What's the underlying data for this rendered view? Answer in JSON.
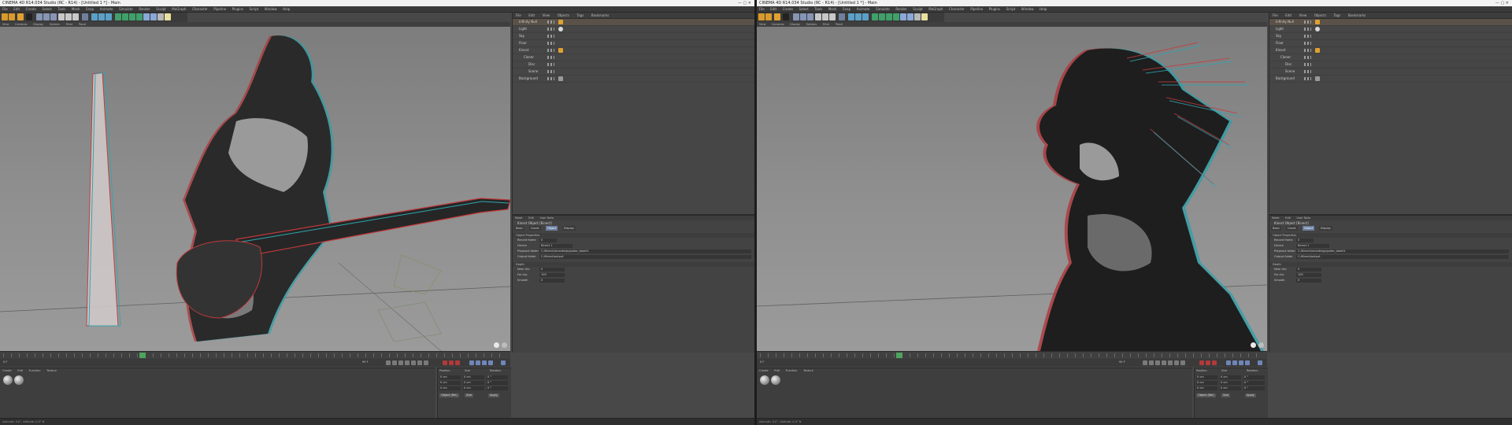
{
  "app": {
    "window_title": "CINEMA 4D R14.034 Studio (RC - R14) - [Untitled 1 *] - Main",
    "window_controls": "—  ▢  ✕"
  },
  "menus": [
    "File",
    "Edit",
    "Create",
    "Select",
    "Tools",
    "Mesh",
    "Snap",
    "Animate",
    "Simulate",
    "Render",
    "Sculpt",
    "MoGraph",
    "Character",
    "Pipeline",
    "Plugins",
    "Script",
    "Window",
    "Help"
  ],
  "viewport": {
    "menu": [
      "View",
      "Cameras",
      "Display",
      "Options",
      "Filter",
      "Panel"
    ]
  },
  "object_manager": {
    "menu": [
      "File",
      "Edit",
      "View",
      "Objects",
      "Tags",
      "Bookmarks"
    ],
    "objects": [
      {
        "name": "Infinity Null",
        "selected": true
      },
      {
        "name": "Light",
        "selected": false
      },
      {
        "name": "Sky",
        "selected": false
      },
      {
        "name": "Floor",
        "selected": false
      },
      {
        "name": "Kinect",
        "selected": false
      },
      {
        "name": "Cloner",
        "selected": false
      },
      {
        "name": "Disc",
        "selected": false
      },
      {
        "name": "Scene",
        "selected": false
      },
      {
        "name": "Background",
        "selected": false
      }
    ]
  },
  "attribute_manager": {
    "tabs": [
      "Mode",
      "Edit",
      "User Data"
    ],
    "title": "Kinect Object [Kinect]",
    "subtabs": [
      "Basic",
      "Coord.",
      "Object",
      "Display"
    ],
    "active_subtab": "Object",
    "section_title": "Object Properties",
    "fields": [
      {
        "key": "Record frame",
        "value": "0"
      },
      {
        "key": "Device",
        "value": "Kinect 1"
      },
      {
        "key": "Playback folder",
        "value": "C:/Kinect/recordings/guitar_take01"
      },
      {
        "key": "Output folder",
        "value": "C:/Kinect/output"
      }
    ],
    "section2": "Depth",
    "fields2": [
      {
        "key": "Near clip",
        "value": "0"
      },
      {
        "key": "Far clip",
        "value": "100"
      },
      {
        "key": "Smooth",
        "value": "0"
      }
    ]
  },
  "timeline": {
    "start": "0 F",
    "end": "90 F",
    "current_frame": "27 F",
    "playhead_fraction": 0.27
  },
  "material_manager": {
    "menu": [
      "Create",
      "Edit",
      "Function",
      "Texture"
    ]
  },
  "coordinates": {
    "headers": [
      "Position",
      "Size",
      "Rotation"
    ],
    "rows": [
      [
        "X",
        "0 cm",
        "X",
        "0 cm",
        "H",
        "0 °"
      ],
      [
        "Y",
        "0 cm",
        "Y",
        "0 cm",
        "P",
        "0 °"
      ],
      [
        "Z",
        "0 cm",
        "Z",
        "0 cm",
        "B",
        "0 °"
      ]
    ],
    "mode": "Object (Rel)",
    "size_mode": "Size",
    "apply_label": "Apply"
  },
  "statusbar": "Azimuth: 0.0°, Altitude: 0.0° N",
  "colors": {
    "accent_orange": "#e0a030",
    "selection": "#5a5248",
    "active_tab": "#6b7fa0",
    "playhead": "#4ea35e",
    "record": "#b03a3a"
  }
}
